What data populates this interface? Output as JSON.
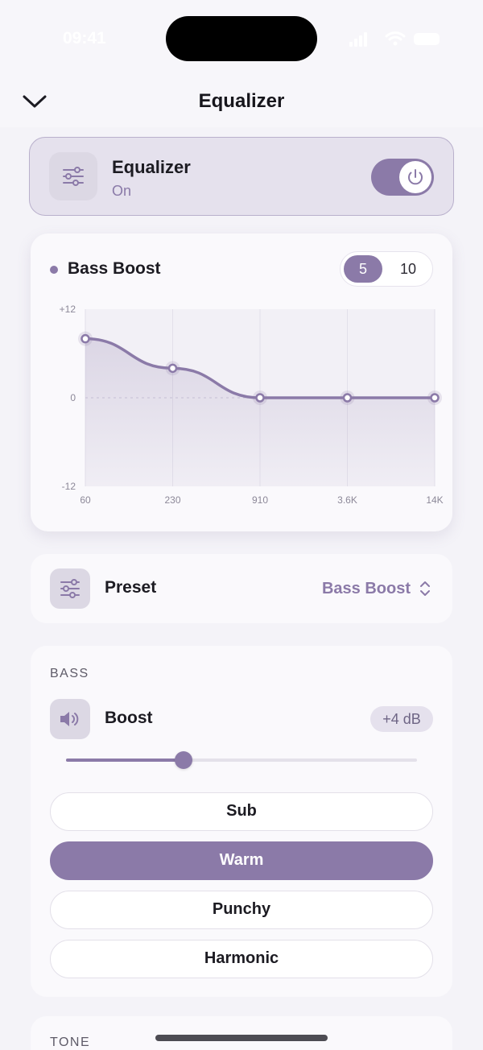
{
  "status_bar": {
    "time": "09:41"
  },
  "header": {
    "title": "Equalizer"
  },
  "equalizer_card": {
    "label": "Equalizer",
    "status": "On",
    "enabled": true
  },
  "chart_card": {
    "title": "Bass Boost",
    "band_options": [
      "5",
      "10"
    ],
    "selected_band_option": "5"
  },
  "chart_data": {
    "type": "line",
    "title": "Bass Boost",
    "categories": [
      "60",
      "230",
      "910",
      "3.6K",
      "14K"
    ],
    "series": [
      {
        "values": [
          8,
          4,
          0,
          0,
          0
        ]
      }
    ],
    "y_tick_labels": [
      "+12",
      "0",
      "-12"
    ],
    "ylim": [
      -12,
      12
    ],
    "grid": true,
    "accent": "#8b7aa8"
  },
  "preset": {
    "label": "Preset",
    "value": "Bass Boost"
  },
  "bass": {
    "section_title": "BASS",
    "boost_label": "Boost",
    "boost_value": "+4 dB",
    "slider_fraction": 0.335,
    "options": [
      "Sub",
      "Warm",
      "Punchy",
      "Harmonic"
    ],
    "selected": "Warm"
  },
  "tone": {
    "section_title": "TONE"
  },
  "colors": {
    "accent": "#8b7aa8",
    "accent_light": "#e5e1ed",
    "background": "#f4f3f8"
  }
}
